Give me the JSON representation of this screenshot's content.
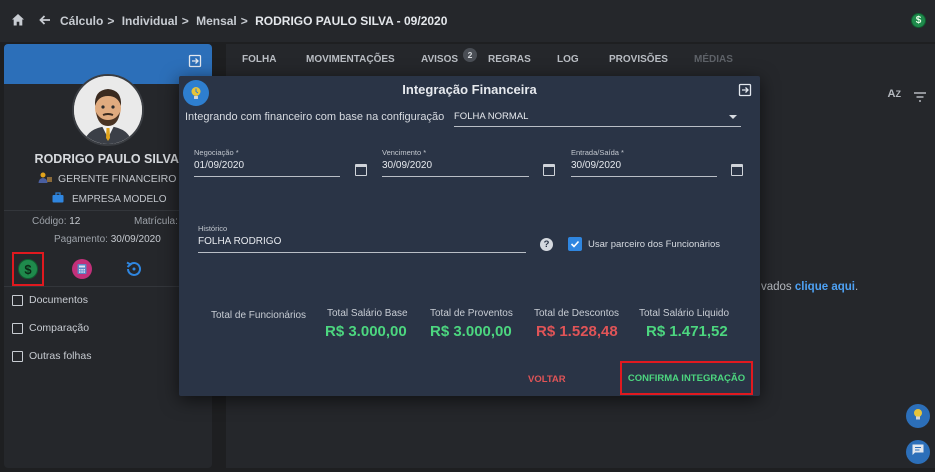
{
  "breadcrumb": {
    "items": [
      "Cálculo",
      "Individual",
      "Mensal",
      "RODRIGO PAULO SILVA - 09/2020"
    ],
    "separator": ">",
    "last": "RODRIGO PAULO SILVA - 09/2020"
  },
  "profile": {
    "name": "RODRIGO PAULO SILVA",
    "role": "GERENTE FINANCEIRO",
    "company": "EMPRESA MODELO",
    "codigo_label": "Código:",
    "codigo": "12",
    "matricula_label": "Matrícula:",
    "pagamento_label": "Pagamento:",
    "pagamento": "30/09/2020"
  },
  "side_menu": [
    "Documentos",
    "Comparação",
    "Outras folhas"
  ],
  "tabs": [
    {
      "label": "FOLHA"
    },
    {
      "label": "MOVIMENTAÇÕES"
    },
    {
      "label": "AVISOS",
      "badge": "2"
    },
    {
      "label": "REGRAS"
    },
    {
      "label": "LOG"
    },
    {
      "label": "PROVISÕES"
    },
    {
      "label": "MÉDIAS"
    }
  ],
  "background": {
    "text_prefix": "vados",
    "link": "clique aqui",
    "suffix": "."
  },
  "modal": {
    "title": "Integração Financeira",
    "config_label": "Integrando com financeiro com base na configuração",
    "config_value": "FOLHA NORMAL",
    "fields": {
      "negociacao": {
        "label": "Negociação *",
        "value": "01/09/2020"
      },
      "vencimento": {
        "label": "Vencimento *",
        "value": "30/09/2020"
      },
      "entrada": {
        "label": "Entrada/Saída *",
        "value": "30/09/2020"
      },
      "historico": {
        "label": "Histórico",
        "value": "FOLHA RODRIGO"
      }
    },
    "checkbox_label": "Usar parceiro dos Funcionários",
    "checkbox_checked": true,
    "totals": {
      "funcionarios_label": "Total de Funcionários",
      "salario_base_label": "Total Salário Base",
      "salario_base": "R$ 3.000,00",
      "proventos_label": "Total de Proventos",
      "proventos": "R$ 3.000,00",
      "descontos_label": "Total de Descontos",
      "descontos": "R$ 1.528,48",
      "liquido_label": "Total Salário Liquido",
      "liquido": "R$ 1.471,52"
    },
    "btn_voltar": "VOLTAR",
    "btn_confirma": "CONFIRMA INTEGRAÇÃO"
  },
  "colors": {
    "positive": "#4cd67f",
    "negative": "#e05457",
    "accent": "#2f86e0",
    "highlight_border": "#e0191f"
  }
}
